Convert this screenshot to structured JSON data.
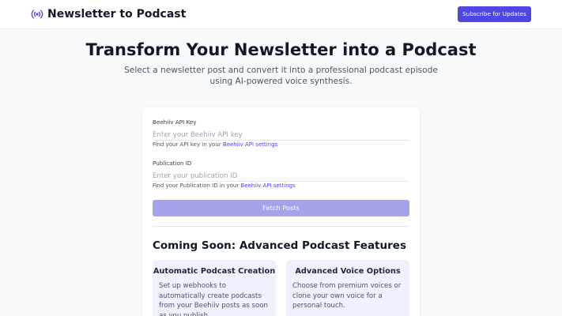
{
  "header": {
    "title": "Newsletter to Podcast",
    "icon": "broadcast-icon",
    "accent_color": "#4f46e5",
    "subscribe_label": "Subscribe for Updates"
  },
  "hero": {
    "title": "Transform Your Newsletter into a Podcast",
    "subtitle": "Select a newsletter post and convert it into a professional podcast episode using AI-powered voice synthesis."
  },
  "form": {
    "api_key": {
      "label": "Beehiiv API Key",
      "placeholder": "Enter your Beehiiv API key",
      "value": "",
      "help_prefix": "Find your API key in your ",
      "help_link": "Beehiiv API settings"
    },
    "publication_id": {
      "label": "Publication ID",
      "placeholder": "Enter your publication ID",
      "value": "",
      "help_prefix": "Find your Publication ID in your ",
      "help_link": "Beehiiv API settings"
    },
    "fetch_label": "Fetch Posts"
  },
  "coming_soon": {
    "title": "Coming Soon: Advanced Podcast Features",
    "features": [
      {
        "title": "Automatic Podcast Creation",
        "description": "Set up webhooks to automatically create podcasts from your Beehiiv posts as soon as you publish."
      },
      {
        "title": "Advanced Voice Options",
        "description": "Choose from premium voices or clone your own voice for a personal touch."
      }
    ]
  }
}
